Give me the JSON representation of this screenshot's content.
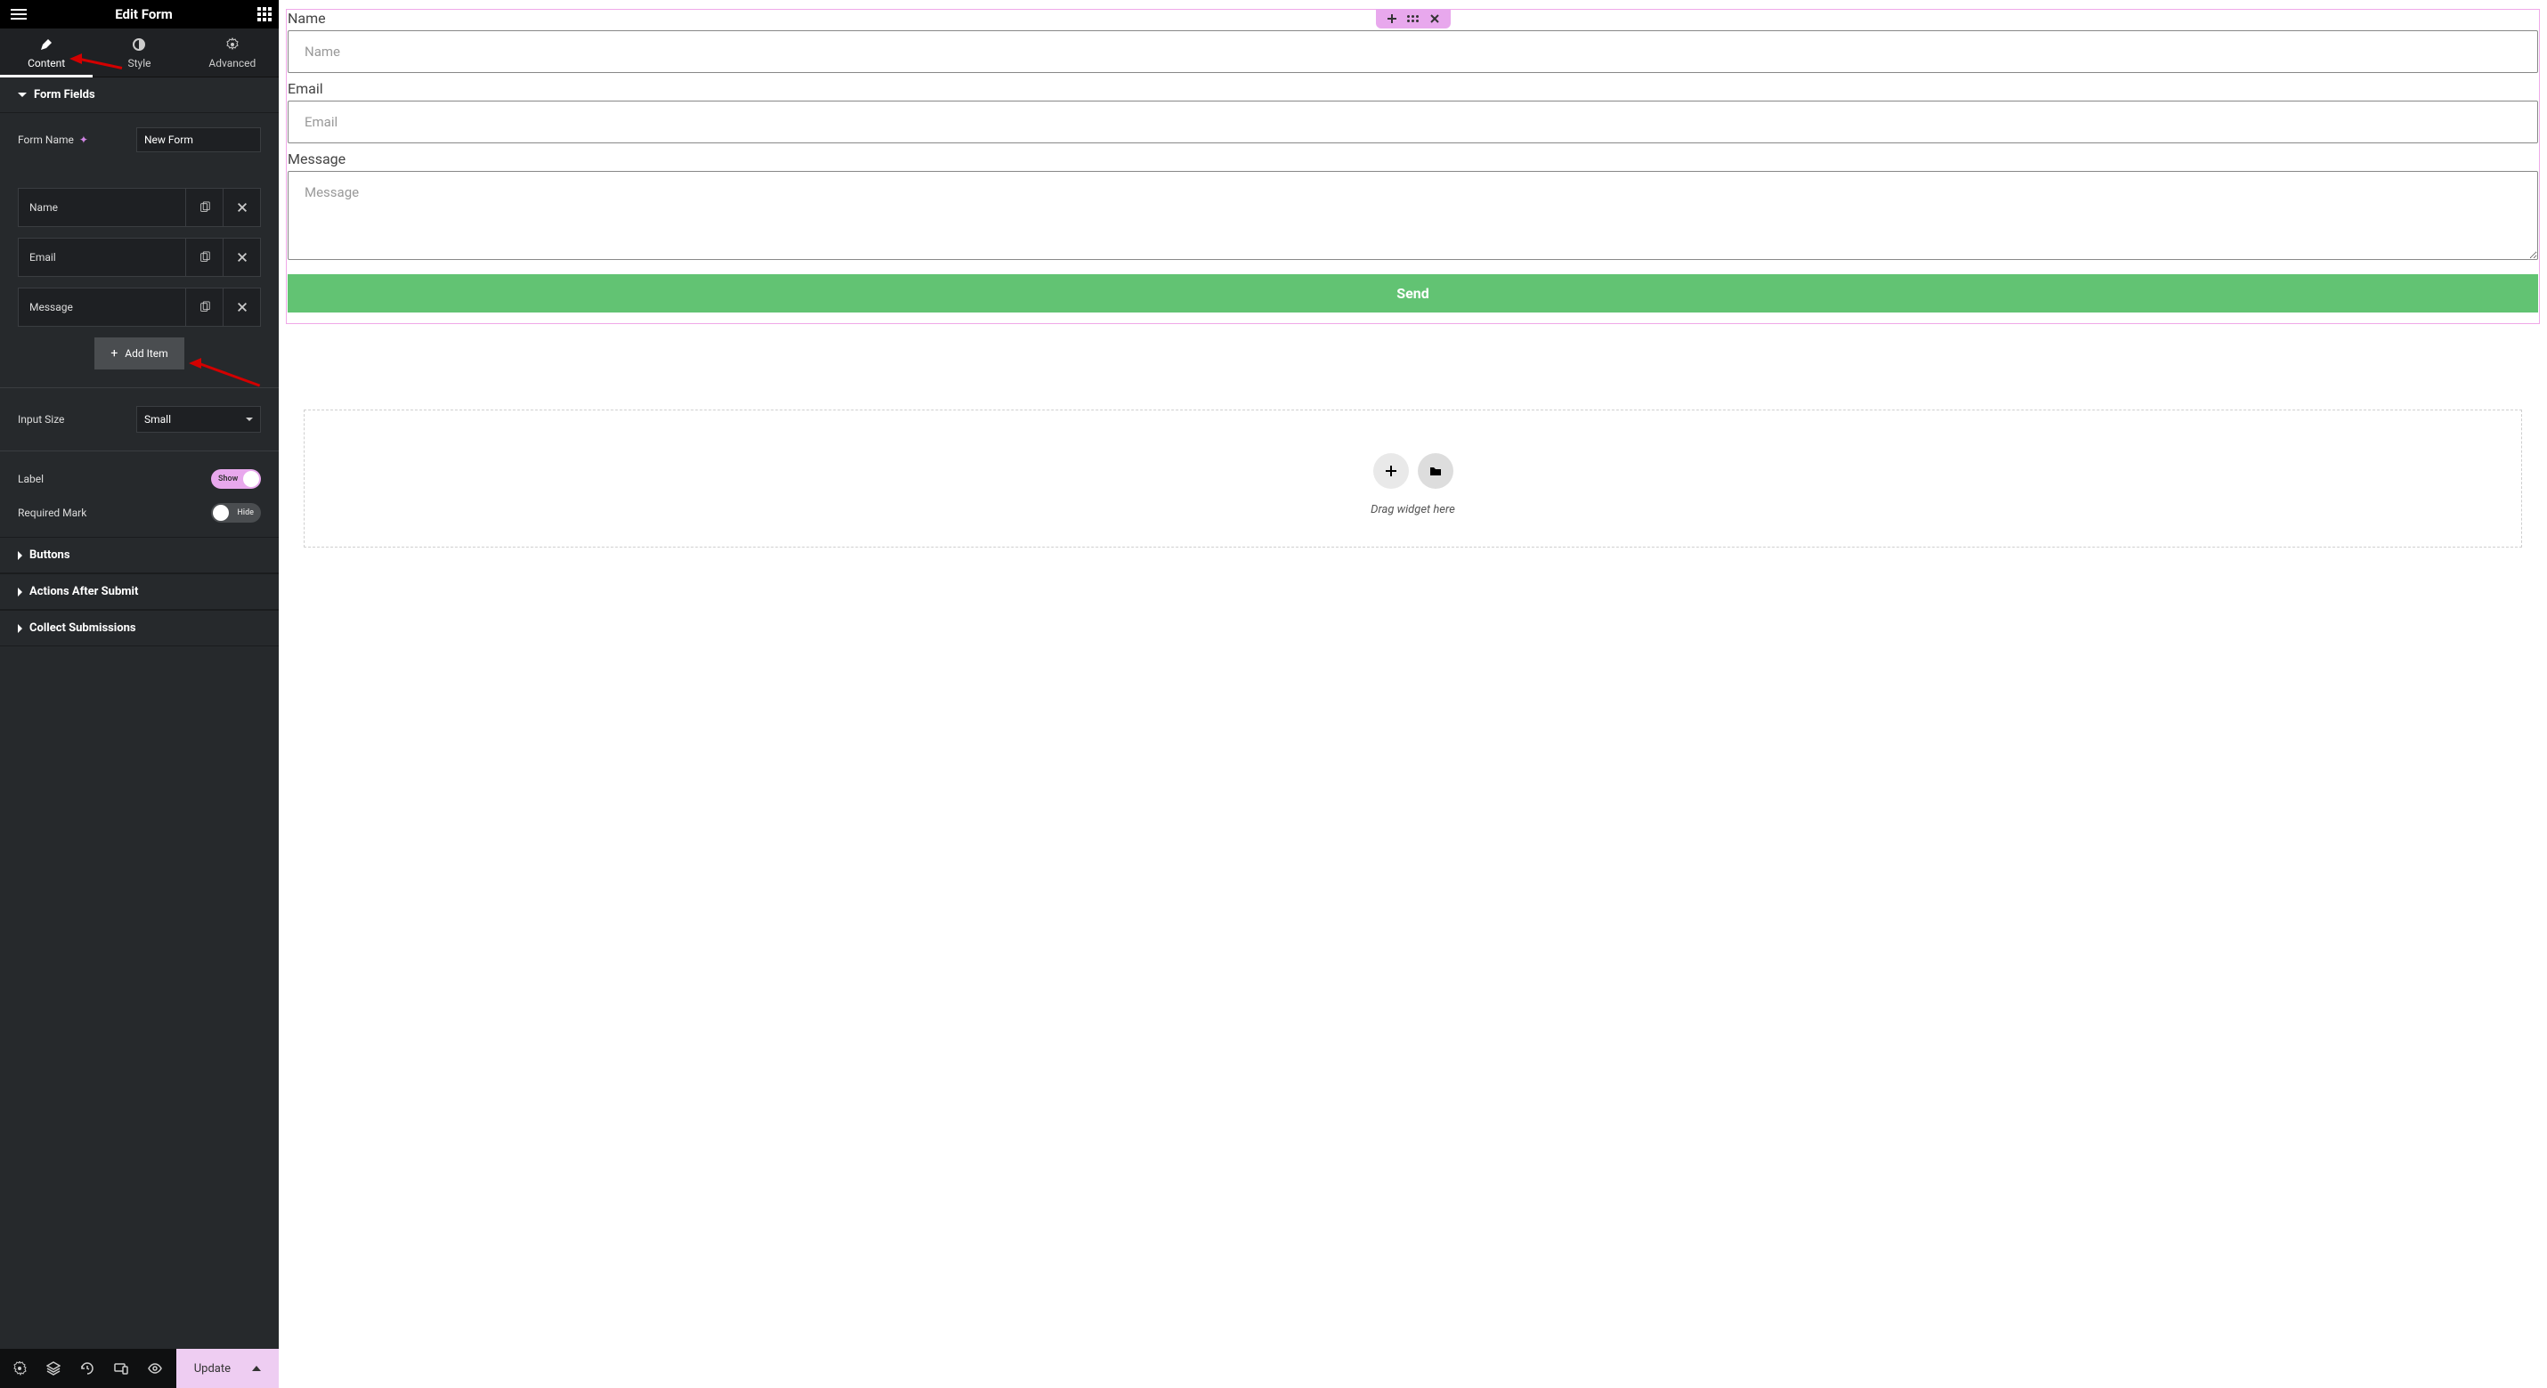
{
  "sidebar": {
    "title": "Edit Form",
    "tabs": {
      "content": "Content",
      "style": "Style",
      "advanced": "Advanced"
    },
    "sections": {
      "form_fields": {
        "title": "Form Fields",
        "form_name_label": "Form Name",
        "form_name_value": "New Form",
        "items": [
          {
            "label": "Name"
          },
          {
            "label": "Email"
          },
          {
            "label": "Message"
          }
        ],
        "add_item_label": "Add Item",
        "input_size_label": "Input Size",
        "input_size_value": "Small",
        "label_label": "Label",
        "label_toggle_text": "Show",
        "required_mark_label": "Required Mark",
        "required_mark_toggle_text": "Hide"
      },
      "buttons": {
        "title": "Buttons"
      },
      "actions": {
        "title": "Actions After Submit"
      },
      "collect": {
        "title": "Collect Submissions"
      }
    },
    "footer": {
      "update": "Update"
    }
  },
  "canvas": {
    "fields": {
      "name": {
        "label": "Name",
        "placeholder": "Name"
      },
      "email": {
        "label": "Email",
        "placeholder": "Email"
      },
      "message": {
        "label": "Message",
        "placeholder": "Message"
      }
    },
    "submit": "Send",
    "dropzone_text": "Drag widget here"
  }
}
